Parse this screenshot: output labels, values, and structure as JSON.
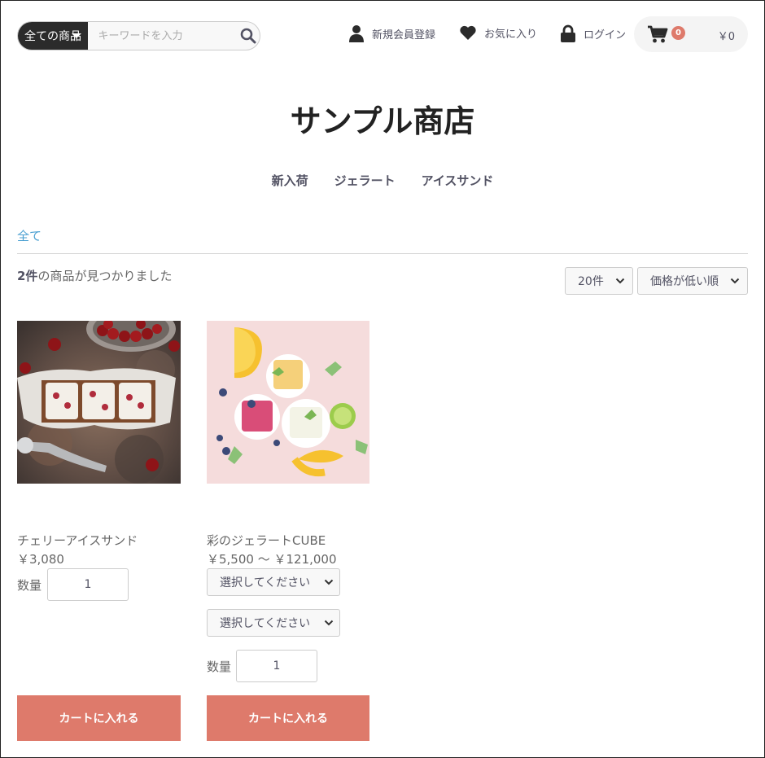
{
  "header": {
    "search": {
      "category": "全ての商品",
      "placeholder": "キーワードを入力"
    },
    "nav": {
      "signup": "新規会員登録",
      "favorites": "お気に入り",
      "login": "ログイン"
    },
    "cart": {
      "count": "0",
      "total": "￥0"
    }
  },
  "shop_name": "サンプル商店",
  "global_nav": [
    "新入荷",
    "ジェラート",
    "アイスサンド"
  ],
  "breadcrumb": "全て",
  "results": {
    "count": "2件",
    "suffix": "の商品が見つかりました"
  },
  "controls": {
    "per_page": "20件",
    "sort": "価格が低い順"
  },
  "products": [
    {
      "name": "チェリーアイスサンド",
      "price": "￥3,080",
      "qty_label": "数量",
      "qty": "1",
      "button": "カートに入れる"
    },
    {
      "name": "彩のジェラートCUBE",
      "price": "￥5,500 ～ ￥121,000",
      "option1": "選択してください",
      "option2": "選択してください",
      "qty_label": "数量",
      "qty": "1",
      "button": "カートに入れる"
    }
  ],
  "colors": {
    "accent": "#de7a6b",
    "link": "#4a9fd1",
    "dark": "#2b2b2b"
  }
}
